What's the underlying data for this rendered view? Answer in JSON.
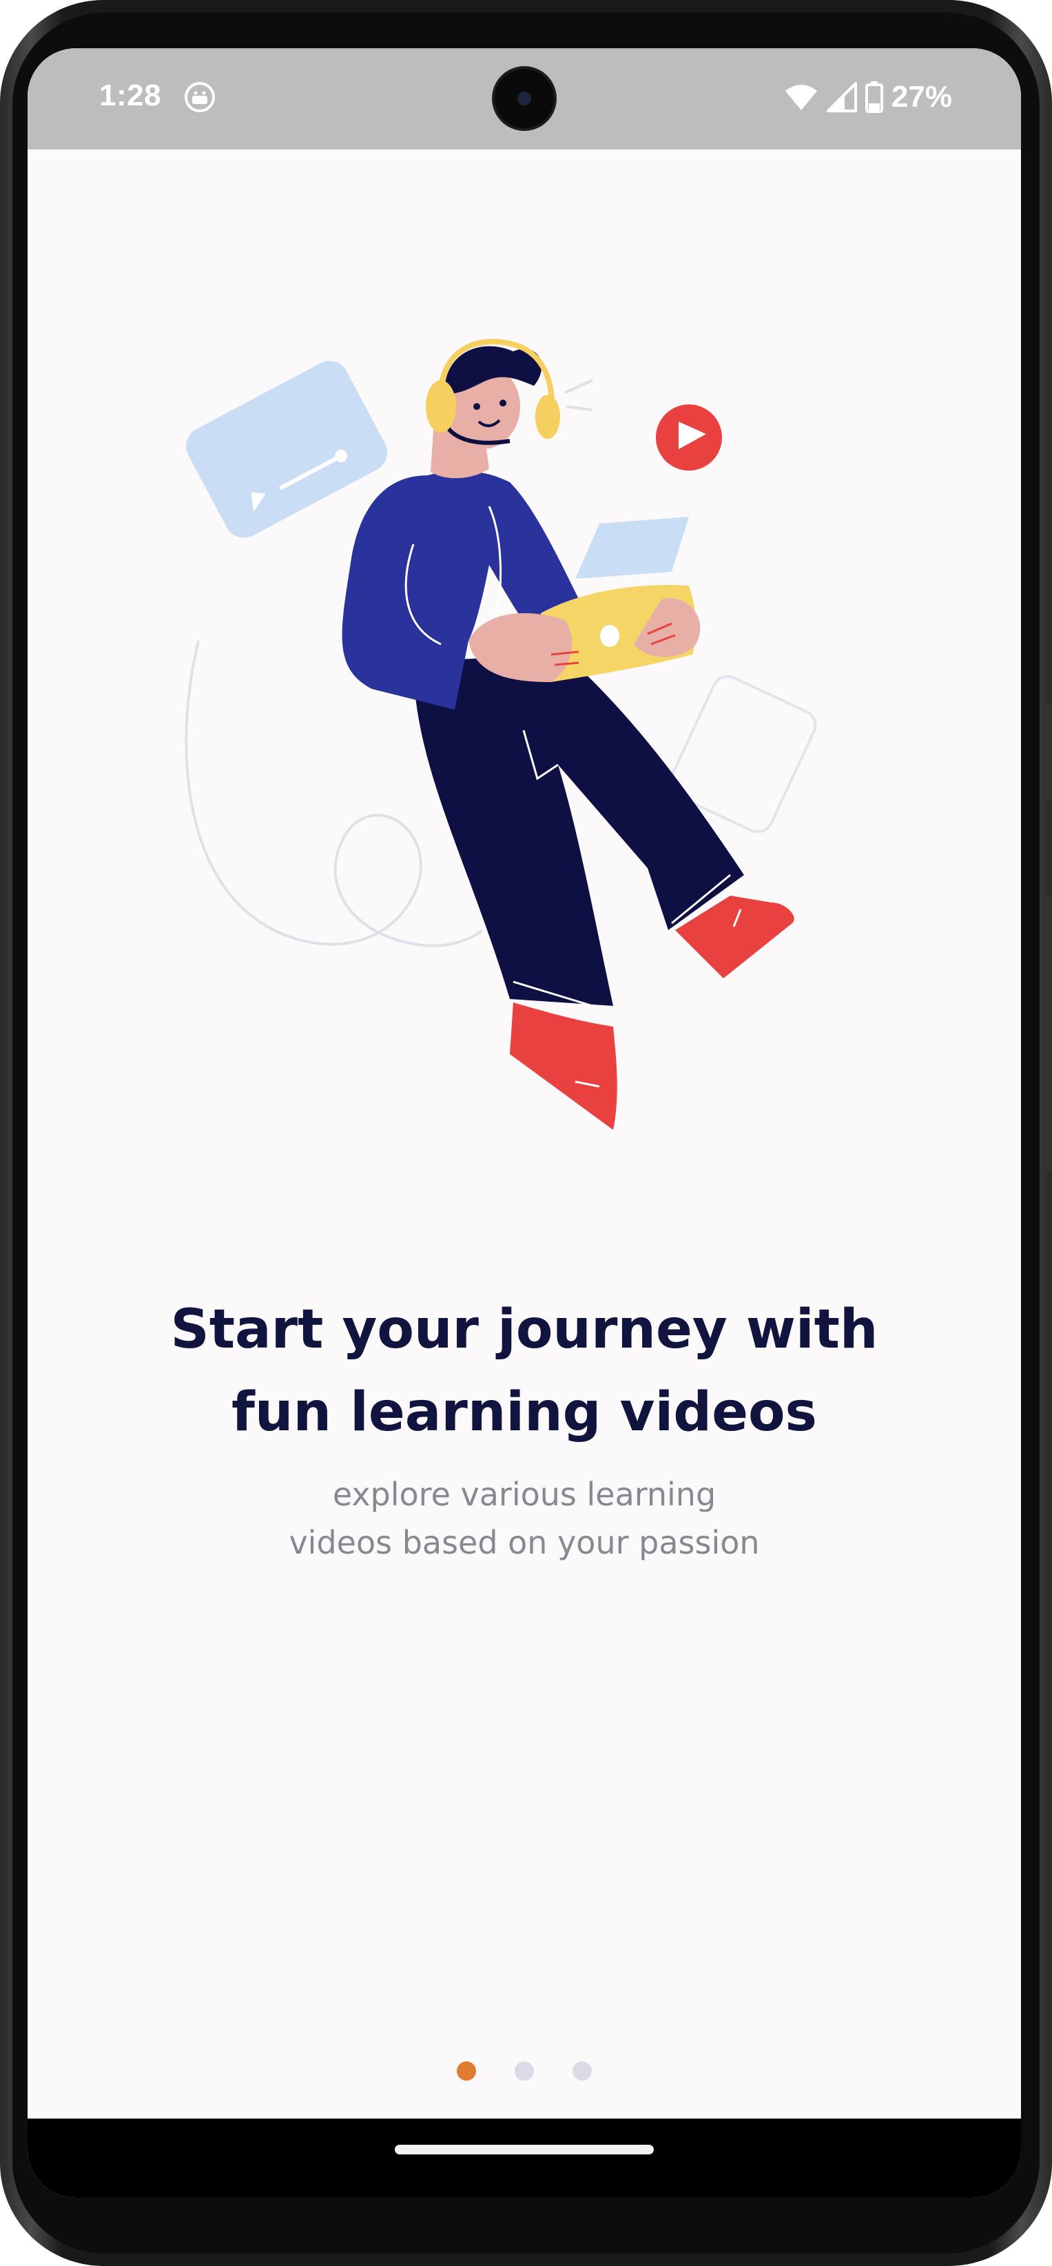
{
  "status_bar": {
    "time": "1:28",
    "app_icon": "android-robot-icon",
    "wifi_icon": "wifi-icon",
    "signal_icon": "cell-signal-icon",
    "battery_icon": "battery-icon",
    "battery_level": "27%"
  },
  "onboarding": {
    "illustration": "person-with-laptop-and-headphones-illustration",
    "title_line1": "Start your journey with",
    "title_line2": "fun learning videos",
    "subtitle_line1": "explore various learning",
    "subtitle_line2": "videos based on your passion",
    "page_indicator": {
      "total": 3,
      "current": 1,
      "active_color": "#e07b32",
      "inactive_color": "#dcdae6"
    }
  },
  "colors": {
    "background": "#fcf9fb",
    "status_bar": "#bdbcbe",
    "title": "#121440",
    "subtitle": "#8a8790"
  }
}
